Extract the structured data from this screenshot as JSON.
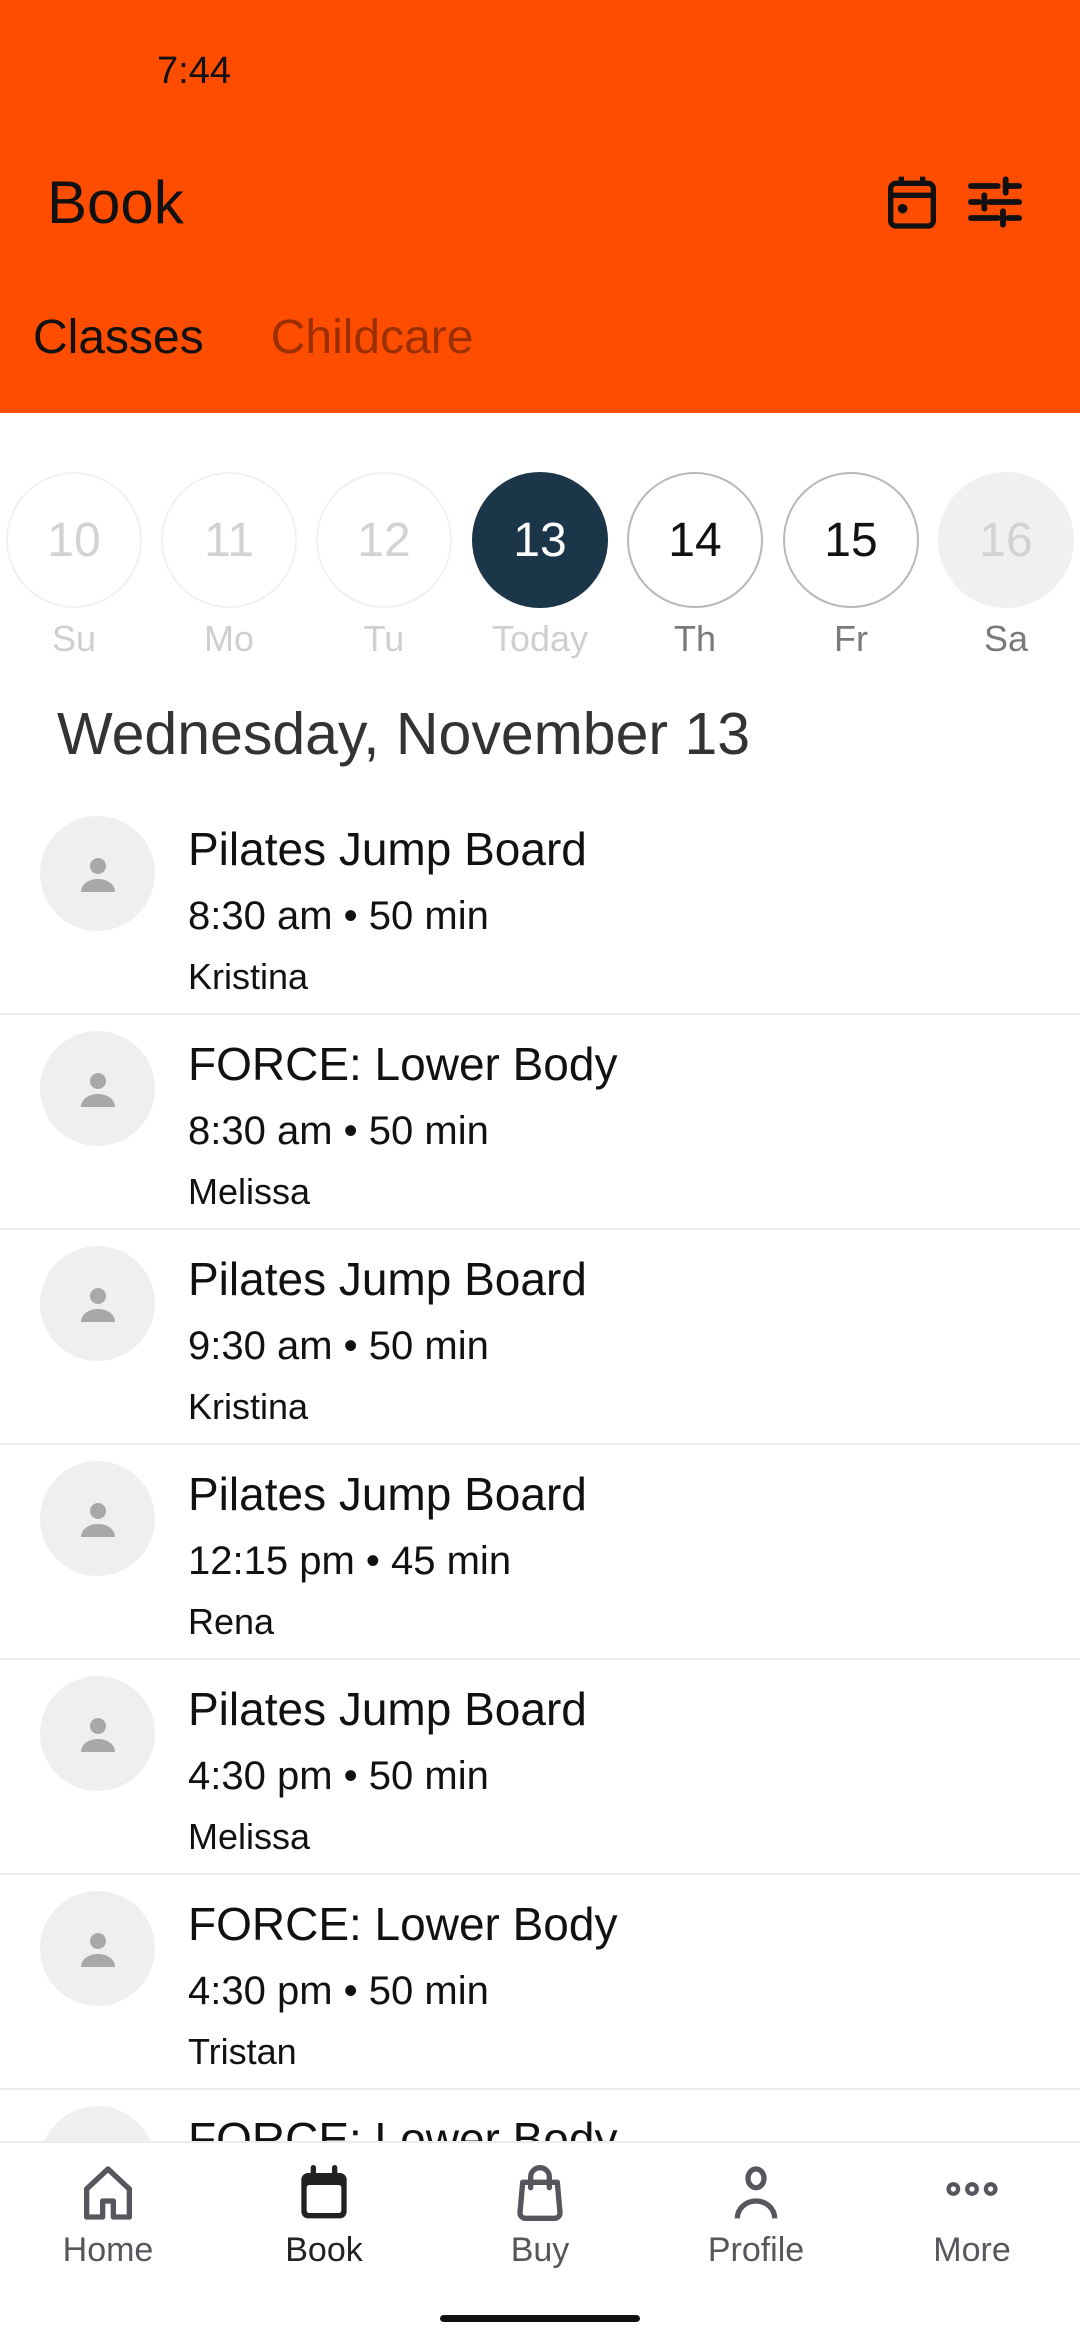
{
  "status_bar": {
    "time": "7:44"
  },
  "header": {
    "title": "Book",
    "icons": [
      "calendar-icon",
      "filter-sliders-icon"
    ],
    "accent_color": "#FF4D00"
  },
  "tabs": [
    {
      "label": "Classes",
      "active": true
    },
    {
      "label": "Childcare",
      "active": false
    }
  ],
  "date_strip": {
    "days": [
      {
        "number": "10",
        "label": "Su",
        "state": "past"
      },
      {
        "number": "11",
        "label": "Mo",
        "state": "past"
      },
      {
        "number": "12",
        "label": "Tu",
        "state": "past"
      },
      {
        "number": "13",
        "label": "Today",
        "state": "today"
      },
      {
        "number": "14",
        "label": "Th",
        "state": "future"
      },
      {
        "number": "15",
        "label": "Fr",
        "state": "future"
      },
      {
        "number": "16",
        "label": "Sa",
        "state": "unavailable"
      }
    ],
    "selected_color": "#1B3549"
  },
  "selected_date_heading": "Wednesday, November 13",
  "classes": [
    {
      "title": "Pilates Jump Board",
      "time": "8:30 am • 50 min",
      "instructor": "Kristina"
    },
    {
      "title": "FORCE: Lower Body",
      "time": "8:30 am • 50 min",
      "instructor": "Melissa"
    },
    {
      "title": "Pilates Jump Board",
      "time": "9:30 am • 50 min",
      "instructor": "Kristina"
    },
    {
      "title": "Pilates Jump Board",
      "time": "12:15 pm • 45 min",
      "instructor": "Rena"
    },
    {
      "title": "Pilates Jump Board",
      "time": "4:30 pm • 50 min",
      "instructor": "Melissa"
    },
    {
      "title": "FORCE: Lower Body",
      "time": "4:30 pm • 50 min",
      "instructor": "Tristan"
    },
    {
      "title": "FORCE: Lower Body",
      "time": "",
      "instructor": ""
    }
  ],
  "bottom_nav": [
    {
      "label": "Home",
      "icon": "home-icon",
      "active": false
    },
    {
      "label": "Book",
      "icon": "calendar-icon",
      "active": true
    },
    {
      "label": "Buy",
      "icon": "shopping-bag-icon",
      "active": false
    },
    {
      "label": "Profile",
      "icon": "person-icon",
      "active": false
    },
    {
      "label": "More",
      "icon": "more-dots-icon",
      "active": false
    }
  ]
}
